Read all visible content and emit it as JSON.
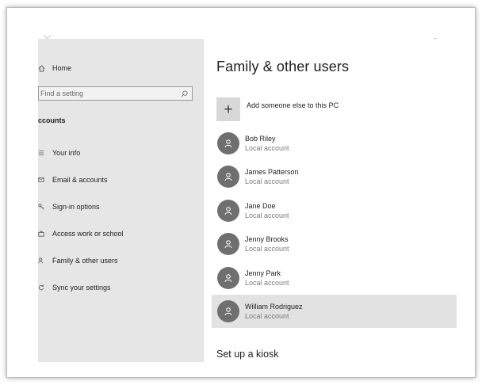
{
  "sidebar": {
    "home_label": "Home",
    "search_placeholder": "Find a setting",
    "section_title": "ccounts",
    "items": [
      {
        "label": "Your info",
        "icon": "contact-card-icon"
      },
      {
        "label": "Email & accounts",
        "icon": "mail-icon"
      },
      {
        "label": "Sign-in options",
        "icon": "key-icon"
      },
      {
        "label": "Access work or school",
        "icon": "briefcase-icon"
      },
      {
        "label": "Family & other users",
        "icon": "person-add-icon"
      },
      {
        "label": "Sync your settings",
        "icon": "sync-icon"
      }
    ]
  },
  "main": {
    "title": "Family & other users",
    "add_label": "Add someone else to this PC",
    "users": [
      {
        "name": "Bob Riley",
        "type": "Local account"
      },
      {
        "name": "James Patterson",
        "type": "Local account"
      },
      {
        "name": "Jane Doe",
        "type": "Local account"
      },
      {
        "name": "Jenny Brooks",
        "type": "Local account"
      },
      {
        "name": "Jenny Park",
        "type": "Local account"
      },
      {
        "name": "William Rodriguez",
        "type": "Local account"
      }
    ],
    "selected_user": "William Rodriguez",
    "kiosk_heading": "Set up a kiosk"
  },
  "colors": {
    "sidebar_bg": "#e6e6e6",
    "avatar_bg": "#6f6f6f",
    "selected_row_bg": "#e2e2e2"
  }
}
